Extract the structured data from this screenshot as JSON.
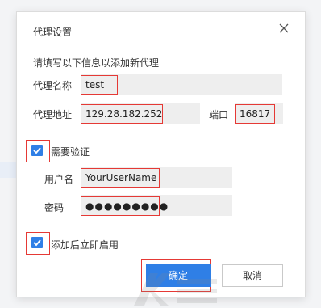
{
  "dialog": {
    "title": "代理设置",
    "hint": "请填写以下信息以添加新代理",
    "name_label": "代理名称",
    "name_value": "test",
    "address_label": "代理地址",
    "address_value": "129.28.182.252",
    "port_label": "端口",
    "port_value": "16817",
    "auth_label": "需要验证",
    "auth_checked": true,
    "username_label": "用户名",
    "username_value": "YourUserName",
    "password_label": "密码",
    "password_value": "●●●●●●●●●",
    "enable_label": "添加后立即启用",
    "enable_checked": true,
    "ok_label": "确定",
    "cancel_label": "取消"
  },
  "colors": {
    "accent": "#2f7fe6",
    "highlight": "#e53935",
    "field_bg": "#eeeeee"
  },
  "icons": {
    "close": "close-icon",
    "check": "checkmark-icon"
  }
}
